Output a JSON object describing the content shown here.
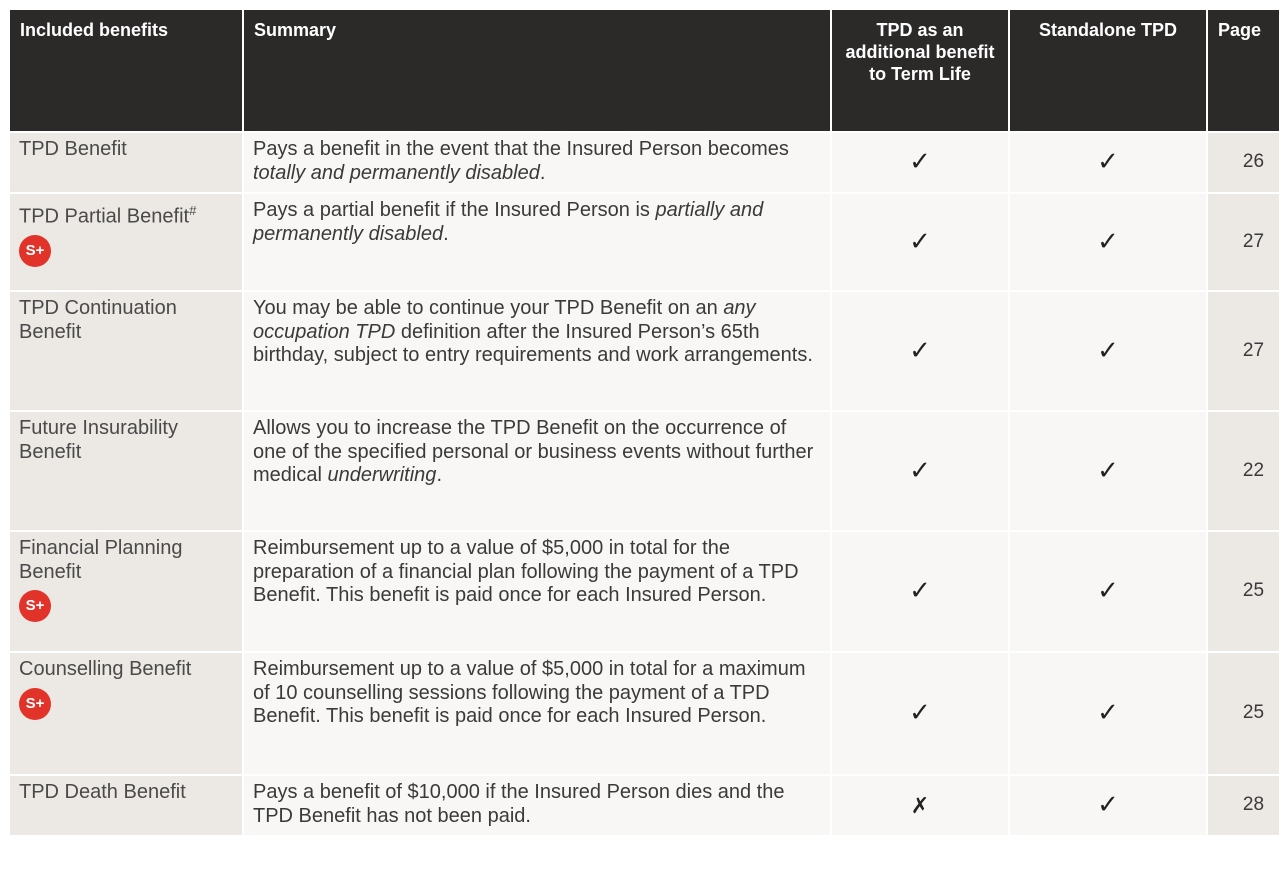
{
  "headers": {
    "benefits": "Included benefits",
    "summary": "Summary",
    "tpd_additional": "TPD as an additional benefit to Term Life",
    "standalone": "Standalone TPD",
    "page": "Page"
  },
  "badge_text": "S+",
  "badge_color": "#e2332b",
  "header_color": "#2c2a29",
  "check_icon": "check-icon",
  "cross_icon": "cross-icon",
  "rows": [
    {
      "benefit": "TPD Benefit",
      "summary_a": "Pays a benefit in the event that the Insured Person becomes ",
      "summary_em": "totally and permanently disabled",
      "summary_b": ".",
      "tpd_additional": "✓",
      "standalone": "✓",
      "page": "26"
    },
    {
      "benefit": "TPD Partial Benefit",
      "benefit_sup": "#",
      "summary_a": "Pays a partial benefit if the Insured Person is ",
      "summary_em": "partially and permanently disabled",
      "summary_b": ".",
      "tpd_additional": "✓",
      "standalone": "✓",
      "page": "27"
    },
    {
      "benefit": "TPD Continuation Benefit",
      "summary_a": "You may be able to continue your TPD Benefit on an ",
      "summary_em": "any occupation TPD",
      "summary_b": " definition after the Insured Person’s 65th birthday, subject to entry requirements and work arrangements.",
      "tpd_additional": "✓",
      "standalone": "✓",
      "page": "27"
    },
    {
      "benefit": "Future Insurability Benefit",
      "summary_a": "Allows you to increase the TPD Benefit on the occurrence of one of the specified personal or business events without further medical ",
      "summary_em": "underwriting",
      "summary_b": ".",
      "tpd_additional": "✓",
      "standalone": "✓",
      "page": "22"
    },
    {
      "benefit": "Financial Planning Benefit",
      "summary_a": "Reimbursement up to a value of $5,000 in total for the preparation of a financial plan following the payment of a TPD Benefit. This benefit is paid once for each Insured Person.",
      "tpd_additional": "✓",
      "standalone": "✓",
      "page": "25"
    },
    {
      "benefit": "Counselling Benefit",
      "summary_a": "Reimbursement up to a value of $5,000 in total for a maximum of 10 counselling sessions following the payment of a TPD Benefit. This benefit is paid once for each Insured Person.",
      "tpd_additional": "✓",
      "standalone": "✓",
      "page": "25"
    },
    {
      "benefit": "TPD Death Benefit",
      "summary_a": "Pays a benefit of $10,000 if the Insured Person dies and the TPD Benefit has not been paid.",
      "tpd_additional": "✗",
      "standalone": "✓",
      "page": "28"
    }
  ]
}
